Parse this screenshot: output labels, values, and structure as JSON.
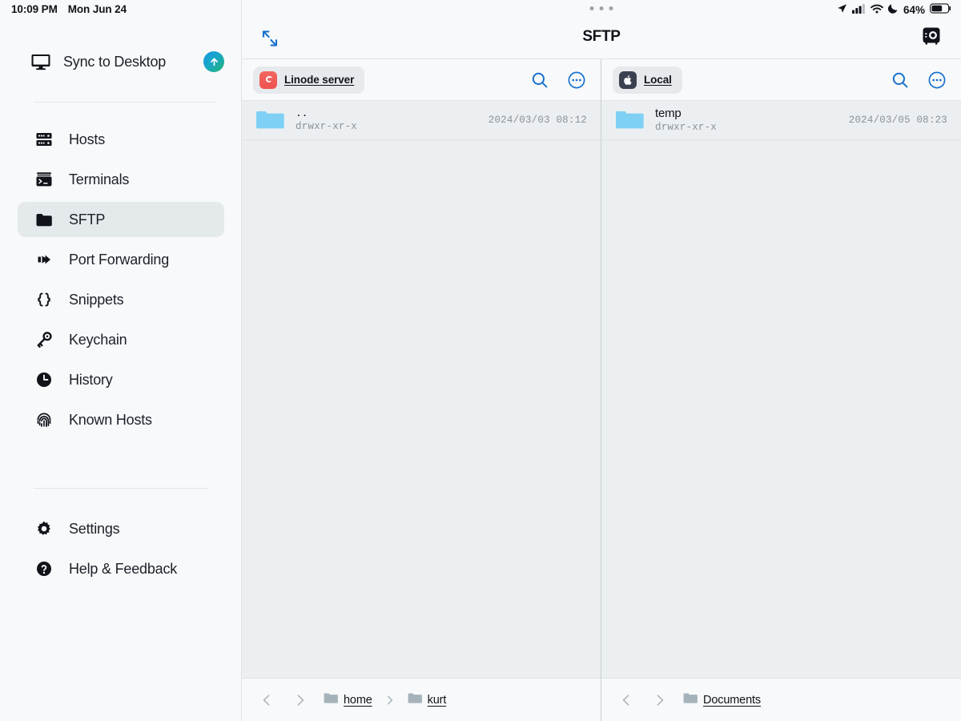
{
  "status_bar": {
    "time": "10:09 PM",
    "date": "Mon Jun 24",
    "battery_percent": "64%",
    "icons": [
      "location-arrow-icon",
      "cellular-signal-icon",
      "wifi-icon",
      "do-not-disturb-moon-icon",
      "battery-icon"
    ]
  },
  "sidebar": {
    "sync": {
      "label": "Sync to Desktop",
      "icon": "desktop-monitor-icon",
      "button_icon": "arrow-up-icon"
    },
    "items": [
      {
        "label": "Hosts",
        "icon": "server-rack-icon",
        "active": false
      },
      {
        "label": "Terminals",
        "icon": "terminal-icon",
        "active": false
      },
      {
        "label": "SFTP",
        "icon": "folder-icon",
        "active": true
      },
      {
        "label": "Port Forwarding",
        "icon": "arrow-forward-icon",
        "active": false
      },
      {
        "label": "Snippets",
        "icon": "curly-braces-icon",
        "active": false
      },
      {
        "label": "Keychain",
        "icon": "key-icon",
        "active": false
      },
      {
        "label": "History",
        "icon": "clock-icon",
        "active": false
      },
      {
        "label": "Known Hosts",
        "icon": "fingerprint-icon",
        "active": false
      }
    ],
    "footer_items": [
      {
        "label": "Settings",
        "icon": "gear-icon"
      },
      {
        "label": "Help & Feedback",
        "icon": "question-circle-icon"
      }
    ]
  },
  "topbar": {
    "title": "SFTP",
    "expand_icon": "expand-diagonal-arrows-icon",
    "vault_icon": "vault-safe-icon",
    "grabber_icon": "window-grabber-dots-icon"
  },
  "panes": [
    {
      "side": "left",
      "connection": {
        "label": "Linode server",
        "icon": "debian-logo-icon",
        "icon_color": "#ef5350"
      },
      "actions": {
        "search_icon": "search-icon",
        "more_icon": "more-options-icon"
      },
      "files": [
        {
          "name": "..",
          "permissions": "drwxr-xr-x",
          "date": "2024/03/03 08:12",
          "icon": "folder-icon",
          "is_parent": true
        }
      ],
      "breadcrumb": {
        "back_icon": "chevron-left-icon",
        "forward_icon": "chevron-right-icon",
        "crumbs": [
          "home",
          "kurt"
        ]
      }
    },
    {
      "side": "right",
      "connection": {
        "label": "Local",
        "icon": "apple-logo-icon",
        "icon_color": "#3c4152"
      },
      "actions": {
        "search_icon": "search-icon",
        "more_icon": "more-options-icon"
      },
      "files": [
        {
          "name": "temp",
          "permissions": "drwxr-xr-x",
          "date": "2024/03/05 08:23",
          "icon": "folder-icon",
          "is_parent": false
        }
      ],
      "breadcrumb": {
        "back_icon": "chevron-left-icon",
        "forward_icon": "chevron-right-icon",
        "crumbs": [
          "Documents"
        ]
      }
    }
  ],
  "colors": {
    "accent_blue": "#1b72cf",
    "sidebar_bg": "#f7f9fa",
    "panel_bg": "#eceff1",
    "active_item_bg": "#e4e9ec",
    "muted_text": "#8b9198"
  }
}
